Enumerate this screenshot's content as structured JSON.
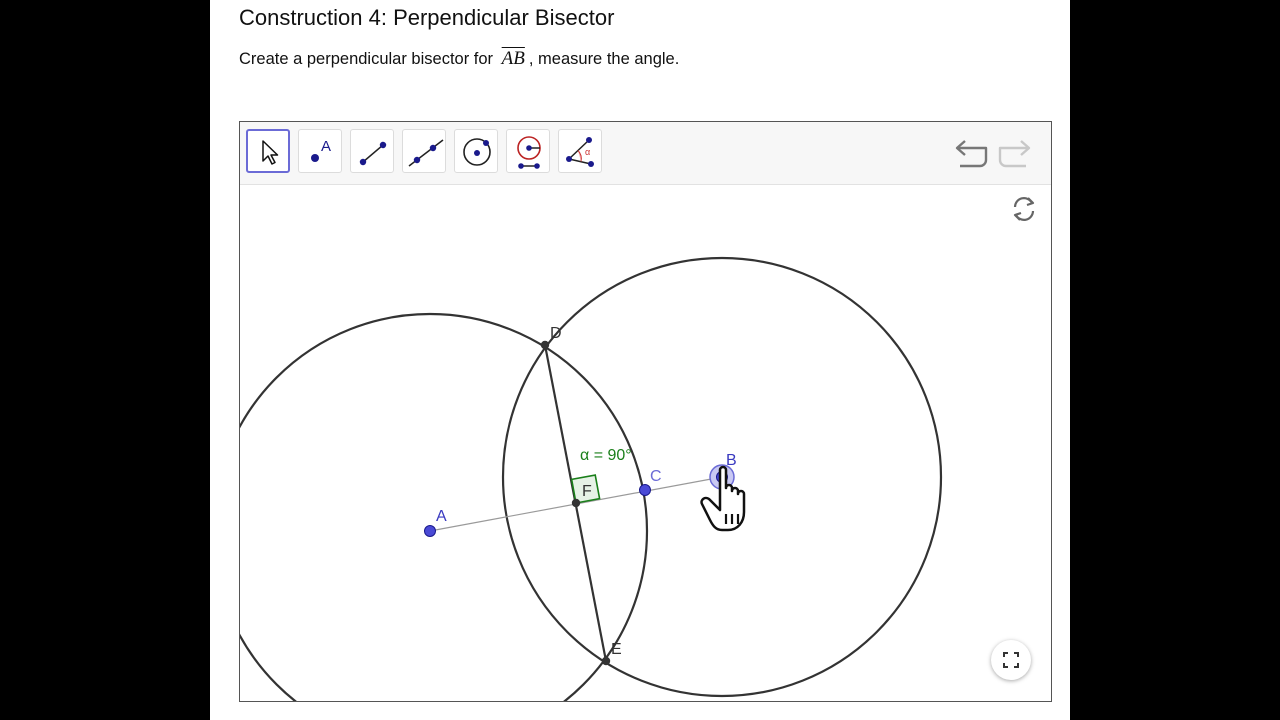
{
  "title": "Construction 4: Perpendicular Bisector",
  "instruction": {
    "before": "Create a perpendicular bisector for",
    "segment": "AB",
    "after": ", measure the angle."
  },
  "toolbar": {
    "tools": [
      "move-tool",
      "point-tool",
      "segment-tool",
      "line-tool",
      "circle-center-point-tool",
      "compass-tool",
      "angle-tool"
    ],
    "selected": "move-tool",
    "angle_tool_glyph": "α",
    "point_tool_glyph": "A"
  },
  "construction": {
    "points": {
      "A": "A",
      "B": "B",
      "C": "C",
      "D": "D",
      "E": "E",
      "F": "F"
    },
    "angle_label": "α = 90°"
  },
  "colors": {
    "point_blue": "#4a4ad6",
    "construction_black": "#333333",
    "angle_green": "#1a7f1a",
    "segment_gray": "#9a9a9a"
  },
  "icons": {
    "undo": "undo-icon",
    "redo": "redo-icon",
    "refresh": "refresh-icon",
    "fullscreen": "fullscreen-icon",
    "cursor": "hand-cursor-icon"
  }
}
